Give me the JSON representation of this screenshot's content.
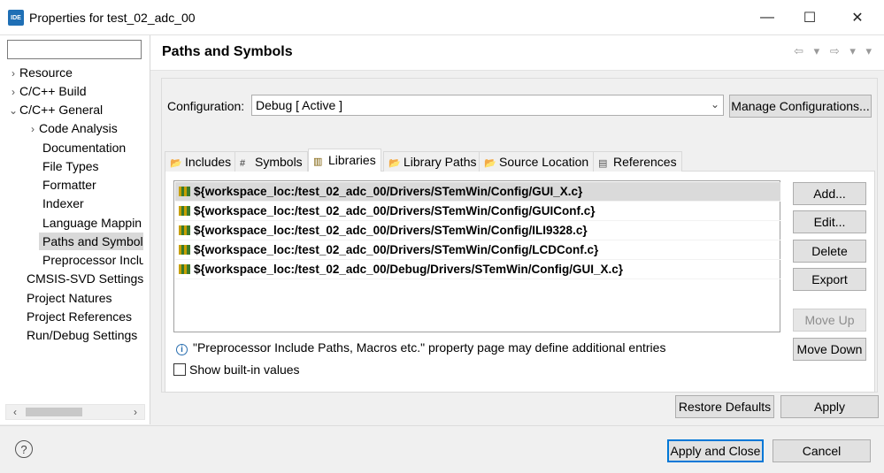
{
  "window": {
    "icon_text": "IDE",
    "title": "Properties for test_02_adc_00",
    "minimize_glyph": "—",
    "maximize_glyph": "☐",
    "close_glyph": "✕"
  },
  "sidebar": {
    "filter_value": "",
    "items": [
      {
        "label": "Resource",
        "twisty": "›",
        "level": 0
      },
      {
        "label": "C/C++ Build",
        "twisty": "›",
        "level": 0
      },
      {
        "label": "C/C++ General",
        "twisty": "⌄",
        "level": 0
      },
      {
        "label": "Code Analysis",
        "twisty": "›",
        "level": 1
      },
      {
        "label": "Documentation",
        "twisty": "",
        "level": 1
      },
      {
        "label": "File Types",
        "twisty": "",
        "level": 1
      },
      {
        "label": "Formatter",
        "twisty": "",
        "level": 1
      },
      {
        "label": "Indexer",
        "twisty": "",
        "level": 1
      },
      {
        "label": "Language Mappin",
        "twisty": "",
        "level": 1
      },
      {
        "label": "Paths and Symbols",
        "twisty": "",
        "level": 1,
        "selected": true
      },
      {
        "label": "Preprocessor Inclu",
        "twisty": "",
        "level": 1
      },
      {
        "label": "CMSIS-SVD Settings",
        "twisty": "",
        "level": 0
      },
      {
        "label": "Project Natures",
        "twisty": "",
        "level": 0
      },
      {
        "label": "Project References",
        "twisty": "",
        "level": 0
      },
      {
        "label": "Run/Debug Settings",
        "twisty": "",
        "level": 0
      }
    ],
    "scroll_left": "‹",
    "scroll_right": "›"
  },
  "page": {
    "title": "Paths and Symbols",
    "nav_back": "⇦ ▾",
    "nav_forward": "⇨ ▾",
    "menu": "▾"
  },
  "configuration": {
    "label": "Configuration:",
    "value": "Debug  [ Active ]",
    "manage_label": "Manage Configurations..."
  },
  "tabs": [
    {
      "label": "Includes",
      "icon": "📂"
    },
    {
      "label": "Symbols",
      "icon": "#"
    },
    {
      "label": "Libraries",
      "icon": "▥",
      "active": true
    },
    {
      "label": "Library Paths",
      "icon": "📂"
    },
    {
      "label": "Source Location",
      "icon": "📂"
    },
    {
      "label": "References",
      "icon": "▤"
    }
  ],
  "libraries": [
    "${workspace_loc:/test_02_adc_00/Drivers/STemWin/Config/GUI_X.c}",
    "${workspace_loc:/test_02_adc_00/Drivers/STemWin/Config/GUIConf.c}",
    "${workspace_loc:/test_02_adc_00/Drivers/STemWin/Config/ILI9328.c}",
    "${workspace_loc:/test_02_adc_00/Drivers/STemWin/Config/LCDConf.c}",
    "${workspace_loc:/test_02_adc_00/Debug/Drivers/STemWin/Config/GUI_X.c}"
  ],
  "list_buttons": {
    "add": "Add...",
    "edit": "Edit...",
    "delete": "Delete",
    "export": "Export",
    "move_up": "Move Up",
    "move_down": "Move Down"
  },
  "info_text": "\"Preprocessor Include Paths, Macros etc.\" property page may define additional entries",
  "show_builtin_label": "Show built-in values",
  "page_buttons": {
    "restore_defaults": "Restore Defaults",
    "apply": "Apply"
  },
  "dialog_buttons": {
    "apply_and_close": "Apply and Close",
    "cancel": "Cancel",
    "help_glyph": "?"
  }
}
